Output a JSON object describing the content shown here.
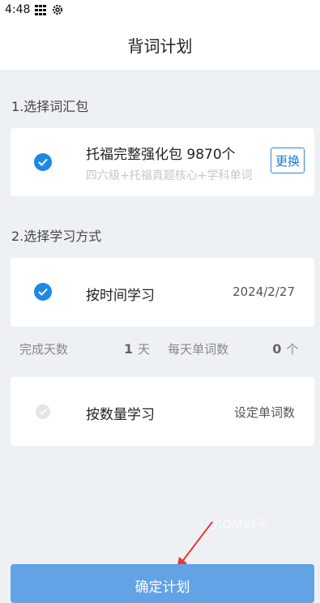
{
  "status_bar": {
    "time": "4:48"
  },
  "header": {
    "title": "背词计划"
  },
  "section1": {
    "title": "1.选择词汇包"
  },
  "vocab_package": {
    "name": "托福完整强化包 9870个",
    "description": "四六级+托福真题核心+学科单词",
    "change_label": "更换",
    "selected": true
  },
  "section2": {
    "title": "2.选择学习方式"
  },
  "mode_time": {
    "label": "按时间学习",
    "date": "2024/2/27",
    "selected": true
  },
  "stats": {
    "days_label": "完成天数",
    "days_value": "1",
    "days_unit": "天",
    "words_label": "每天单词数",
    "words_value": "0",
    "words_unit": "个"
  },
  "mode_count": {
    "label": "按数量学习",
    "action": "设定单词数",
    "selected": false
  },
  "watermark": "ROM助手",
  "confirm_button": {
    "label": "确定计划"
  },
  "colors": {
    "accent": "#1e88e5",
    "button": "#62a3e6",
    "background": "#eef1f4"
  }
}
